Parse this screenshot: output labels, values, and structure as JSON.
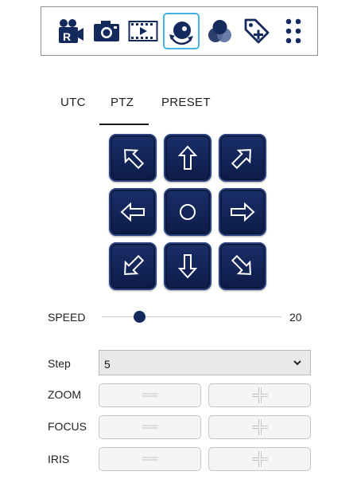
{
  "toolbar": {
    "items": [
      {
        "icon": "record-camera-icon",
        "active": false
      },
      {
        "icon": "snapshot-camera-icon",
        "active": false
      },
      {
        "icon": "playback-film-icon",
        "active": false
      },
      {
        "icon": "ptz-control-icon",
        "active": true
      },
      {
        "icon": "color-adjust-icon",
        "active": false
      },
      {
        "icon": "add-tag-icon",
        "active": false
      },
      {
        "icon": "more-dots-icon",
        "active": false
      }
    ],
    "active_border_color": "#43b3e4",
    "icon_color": "#142a5c"
  },
  "tabs": {
    "items": [
      "UTC",
      "PTZ",
      "PRESET"
    ],
    "selected": "PTZ"
  },
  "ptz_pad": {
    "buttons": [
      {
        "icon": "arrow-up-left-icon"
      },
      {
        "icon": "arrow-up-icon"
      },
      {
        "icon": "arrow-up-right-icon"
      },
      {
        "icon": "arrow-left-icon"
      },
      {
        "icon": "center-home-icon"
      },
      {
        "icon": "arrow-right-icon"
      },
      {
        "icon": "arrow-down-left-icon"
      },
      {
        "icon": "arrow-down-icon"
      },
      {
        "icon": "arrow-down-right-icon"
      }
    ],
    "button_color": "#142a5c"
  },
  "speed": {
    "label": "SPEED",
    "value": "20",
    "slider_fraction": 0.21
  },
  "step": {
    "label": "Step",
    "selected": "5"
  },
  "controls": [
    {
      "label": "ZOOM",
      "minus_icon": "minus-icon",
      "plus_icon": "plus-icon"
    },
    {
      "label": "FOCUS",
      "minus_icon": "minus-icon",
      "plus_icon": "plus-icon"
    },
    {
      "label": "IRIS",
      "minus_icon": "minus-icon",
      "plus_icon": "plus-icon"
    }
  ]
}
